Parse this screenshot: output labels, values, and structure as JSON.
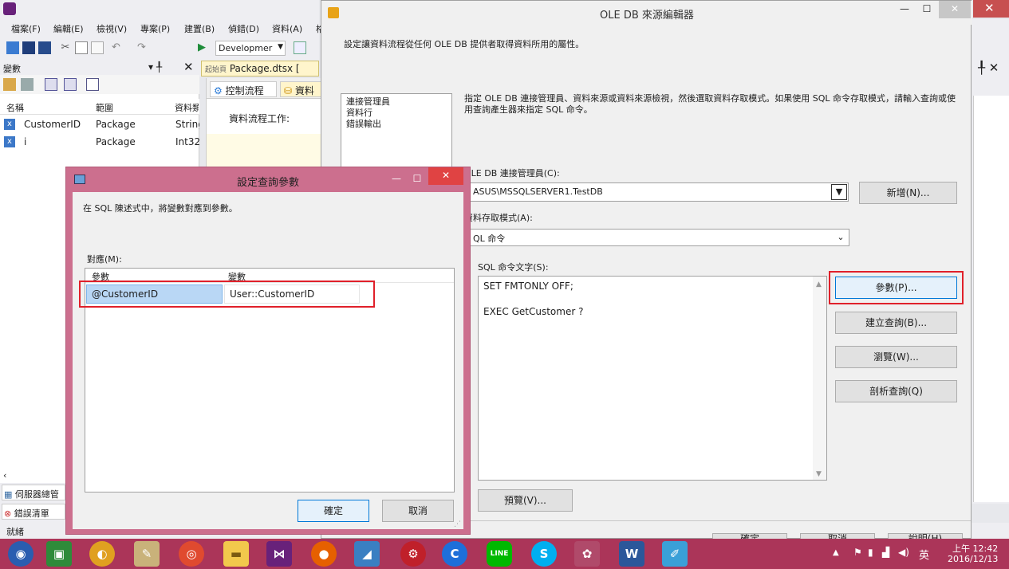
{
  "vs": {
    "menu": [
      "檔案(F)",
      "編輯(E)",
      "檢視(V)",
      "專案(P)",
      "建置(B)",
      "偵錯(D)",
      "資料(A)",
      "格"
    ],
    "config": "Developmer",
    "variables_panel": {
      "title": "變數",
      "pin": "▾ ╀",
      "columns": [
        "名稱",
        "範圍",
        "資料類"
      ],
      "rows": [
        {
          "name": "CustomerID",
          "scope": "Package",
          "type": "String"
        },
        {
          "name": "i",
          "scope": "Package",
          "type": "Int32"
        }
      ]
    },
    "doc_tab": "Package.dtsx [",
    "doc_tab_prefix": "起始頁",
    "designer_tabs": [
      "控制流程",
      "資料"
    ],
    "designer_task_label": "資料流程工作:",
    "bottom_tabs": [
      "伺服器總管",
      "錯誤清單"
    ],
    "status": "就緒",
    "right_pin": "╀ ✕"
  },
  "ole_editor": {
    "title": "OLE DB 來源編輯器",
    "description": "設定讓資料流程從任何 OLE DB 提供者取得資料所用的屬性。",
    "nav": [
      "連接管理員",
      "資料行",
      "錯誤輸出"
    ],
    "instruction": "指定 OLE DB 連接管理員、資料來源或資料來源檢視，然後選取資料存取模式。如果使用 SQL 命令存取模式，請輸入查詢或使用查詢產生器來指定 SQL 命令。",
    "conn_label": "OLE DB 連接管理員(C):",
    "conn_value": "ASUS\\MSSQLSERVER1.TestDB",
    "new_button": "新增(N)...",
    "mode_label": "資料存取模式(A):",
    "mode_value": "QL 命令",
    "sql_label": "SQL 命令文字(S):",
    "sql_lines": [
      "SET FMTONLY OFF;",
      "",
      "EXEC GetCustomer ?"
    ],
    "params_button": "參數(P)...",
    "build_query_button": "建立查詢(B)...",
    "browse_button": "瀏覽(W)...",
    "parse_button": "剖析查詢(Q)",
    "preview_button": "預覽(V)...",
    "ok_button": "確定",
    "cancel_button": "取消",
    "help_button": "說明(H)"
  },
  "param_dialog": {
    "title": "設定查詢參數",
    "description": "在 SQL 陳述式中，將變數對應到參數。",
    "mapping_label": "對應(M):",
    "columns": [
      "參數",
      "變數"
    ],
    "rows": [
      {
        "param": "@CustomerID",
        "variable": "User::CustomerID"
      }
    ],
    "ok_button": "確定",
    "cancel_button": "取消"
  },
  "taskbar": {
    "ime": "英",
    "time": "上午 12:42",
    "date": "2016/12/13"
  },
  "colors": {
    "dialog_border": "#cc6f8e",
    "taskbar": "#ab3559",
    "highlight": "#e0202a",
    "selection": "#b9d7f5"
  }
}
